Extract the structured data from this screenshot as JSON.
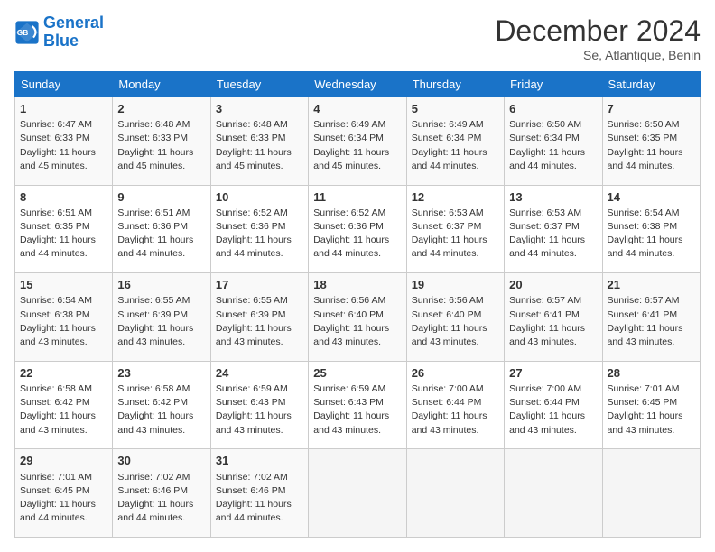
{
  "logo": {
    "line1": "General",
    "line2": "Blue"
  },
  "title": "December 2024",
  "subtitle": "Se, Atlantique, Benin",
  "header_days": [
    "Sunday",
    "Monday",
    "Tuesday",
    "Wednesday",
    "Thursday",
    "Friday",
    "Saturday"
  ],
  "weeks": [
    [
      {
        "day": "1",
        "detail": "Sunrise: 6:47 AM\nSunset: 6:33 PM\nDaylight: 11 hours\nand 45 minutes."
      },
      {
        "day": "2",
        "detail": "Sunrise: 6:48 AM\nSunset: 6:33 PM\nDaylight: 11 hours\nand 45 minutes."
      },
      {
        "day": "3",
        "detail": "Sunrise: 6:48 AM\nSunset: 6:33 PM\nDaylight: 11 hours\nand 45 minutes."
      },
      {
        "day": "4",
        "detail": "Sunrise: 6:49 AM\nSunset: 6:34 PM\nDaylight: 11 hours\nand 45 minutes."
      },
      {
        "day": "5",
        "detail": "Sunrise: 6:49 AM\nSunset: 6:34 PM\nDaylight: 11 hours\nand 44 minutes."
      },
      {
        "day": "6",
        "detail": "Sunrise: 6:50 AM\nSunset: 6:34 PM\nDaylight: 11 hours\nand 44 minutes."
      },
      {
        "day": "7",
        "detail": "Sunrise: 6:50 AM\nSunset: 6:35 PM\nDaylight: 11 hours\nand 44 minutes."
      }
    ],
    [
      {
        "day": "8",
        "detail": "Sunrise: 6:51 AM\nSunset: 6:35 PM\nDaylight: 11 hours\nand 44 minutes."
      },
      {
        "day": "9",
        "detail": "Sunrise: 6:51 AM\nSunset: 6:36 PM\nDaylight: 11 hours\nand 44 minutes."
      },
      {
        "day": "10",
        "detail": "Sunrise: 6:52 AM\nSunset: 6:36 PM\nDaylight: 11 hours\nand 44 minutes."
      },
      {
        "day": "11",
        "detail": "Sunrise: 6:52 AM\nSunset: 6:36 PM\nDaylight: 11 hours\nand 44 minutes."
      },
      {
        "day": "12",
        "detail": "Sunrise: 6:53 AM\nSunset: 6:37 PM\nDaylight: 11 hours\nand 44 minutes."
      },
      {
        "day": "13",
        "detail": "Sunrise: 6:53 AM\nSunset: 6:37 PM\nDaylight: 11 hours\nand 44 minutes."
      },
      {
        "day": "14",
        "detail": "Sunrise: 6:54 AM\nSunset: 6:38 PM\nDaylight: 11 hours\nand 44 minutes."
      }
    ],
    [
      {
        "day": "15",
        "detail": "Sunrise: 6:54 AM\nSunset: 6:38 PM\nDaylight: 11 hours\nand 43 minutes."
      },
      {
        "day": "16",
        "detail": "Sunrise: 6:55 AM\nSunset: 6:39 PM\nDaylight: 11 hours\nand 43 minutes."
      },
      {
        "day": "17",
        "detail": "Sunrise: 6:55 AM\nSunset: 6:39 PM\nDaylight: 11 hours\nand 43 minutes."
      },
      {
        "day": "18",
        "detail": "Sunrise: 6:56 AM\nSunset: 6:40 PM\nDaylight: 11 hours\nand 43 minutes."
      },
      {
        "day": "19",
        "detail": "Sunrise: 6:56 AM\nSunset: 6:40 PM\nDaylight: 11 hours\nand 43 minutes."
      },
      {
        "day": "20",
        "detail": "Sunrise: 6:57 AM\nSunset: 6:41 PM\nDaylight: 11 hours\nand 43 minutes."
      },
      {
        "day": "21",
        "detail": "Sunrise: 6:57 AM\nSunset: 6:41 PM\nDaylight: 11 hours\nand 43 minutes."
      }
    ],
    [
      {
        "day": "22",
        "detail": "Sunrise: 6:58 AM\nSunset: 6:42 PM\nDaylight: 11 hours\nand 43 minutes."
      },
      {
        "day": "23",
        "detail": "Sunrise: 6:58 AM\nSunset: 6:42 PM\nDaylight: 11 hours\nand 43 minutes."
      },
      {
        "day": "24",
        "detail": "Sunrise: 6:59 AM\nSunset: 6:43 PM\nDaylight: 11 hours\nand 43 minutes."
      },
      {
        "day": "25",
        "detail": "Sunrise: 6:59 AM\nSunset: 6:43 PM\nDaylight: 11 hours\nand 43 minutes."
      },
      {
        "day": "26",
        "detail": "Sunrise: 7:00 AM\nSunset: 6:44 PM\nDaylight: 11 hours\nand 43 minutes."
      },
      {
        "day": "27",
        "detail": "Sunrise: 7:00 AM\nSunset: 6:44 PM\nDaylight: 11 hours\nand 43 minutes."
      },
      {
        "day": "28",
        "detail": "Sunrise: 7:01 AM\nSunset: 6:45 PM\nDaylight: 11 hours\nand 43 minutes."
      }
    ],
    [
      {
        "day": "29",
        "detail": "Sunrise: 7:01 AM\nSunset: 6:45 PM\nDaylight: 11 hours\nand 44 minutes."
      },
      {
        "day": "30",
        "detail": "Sunrise: 7:02 AM\nSunset: 6:46 PM\nDaylight: 11 hours\nand 44 minutes."
      },
      {
        "day": "31",
        "detail": "Sunrise: 7:02 AM\nSunset: 6:46 PM\nDaylight: 11 hours\nand 44 minutes."
      },
      null,
      null,
      null,
      null
    ]
  ]
}
